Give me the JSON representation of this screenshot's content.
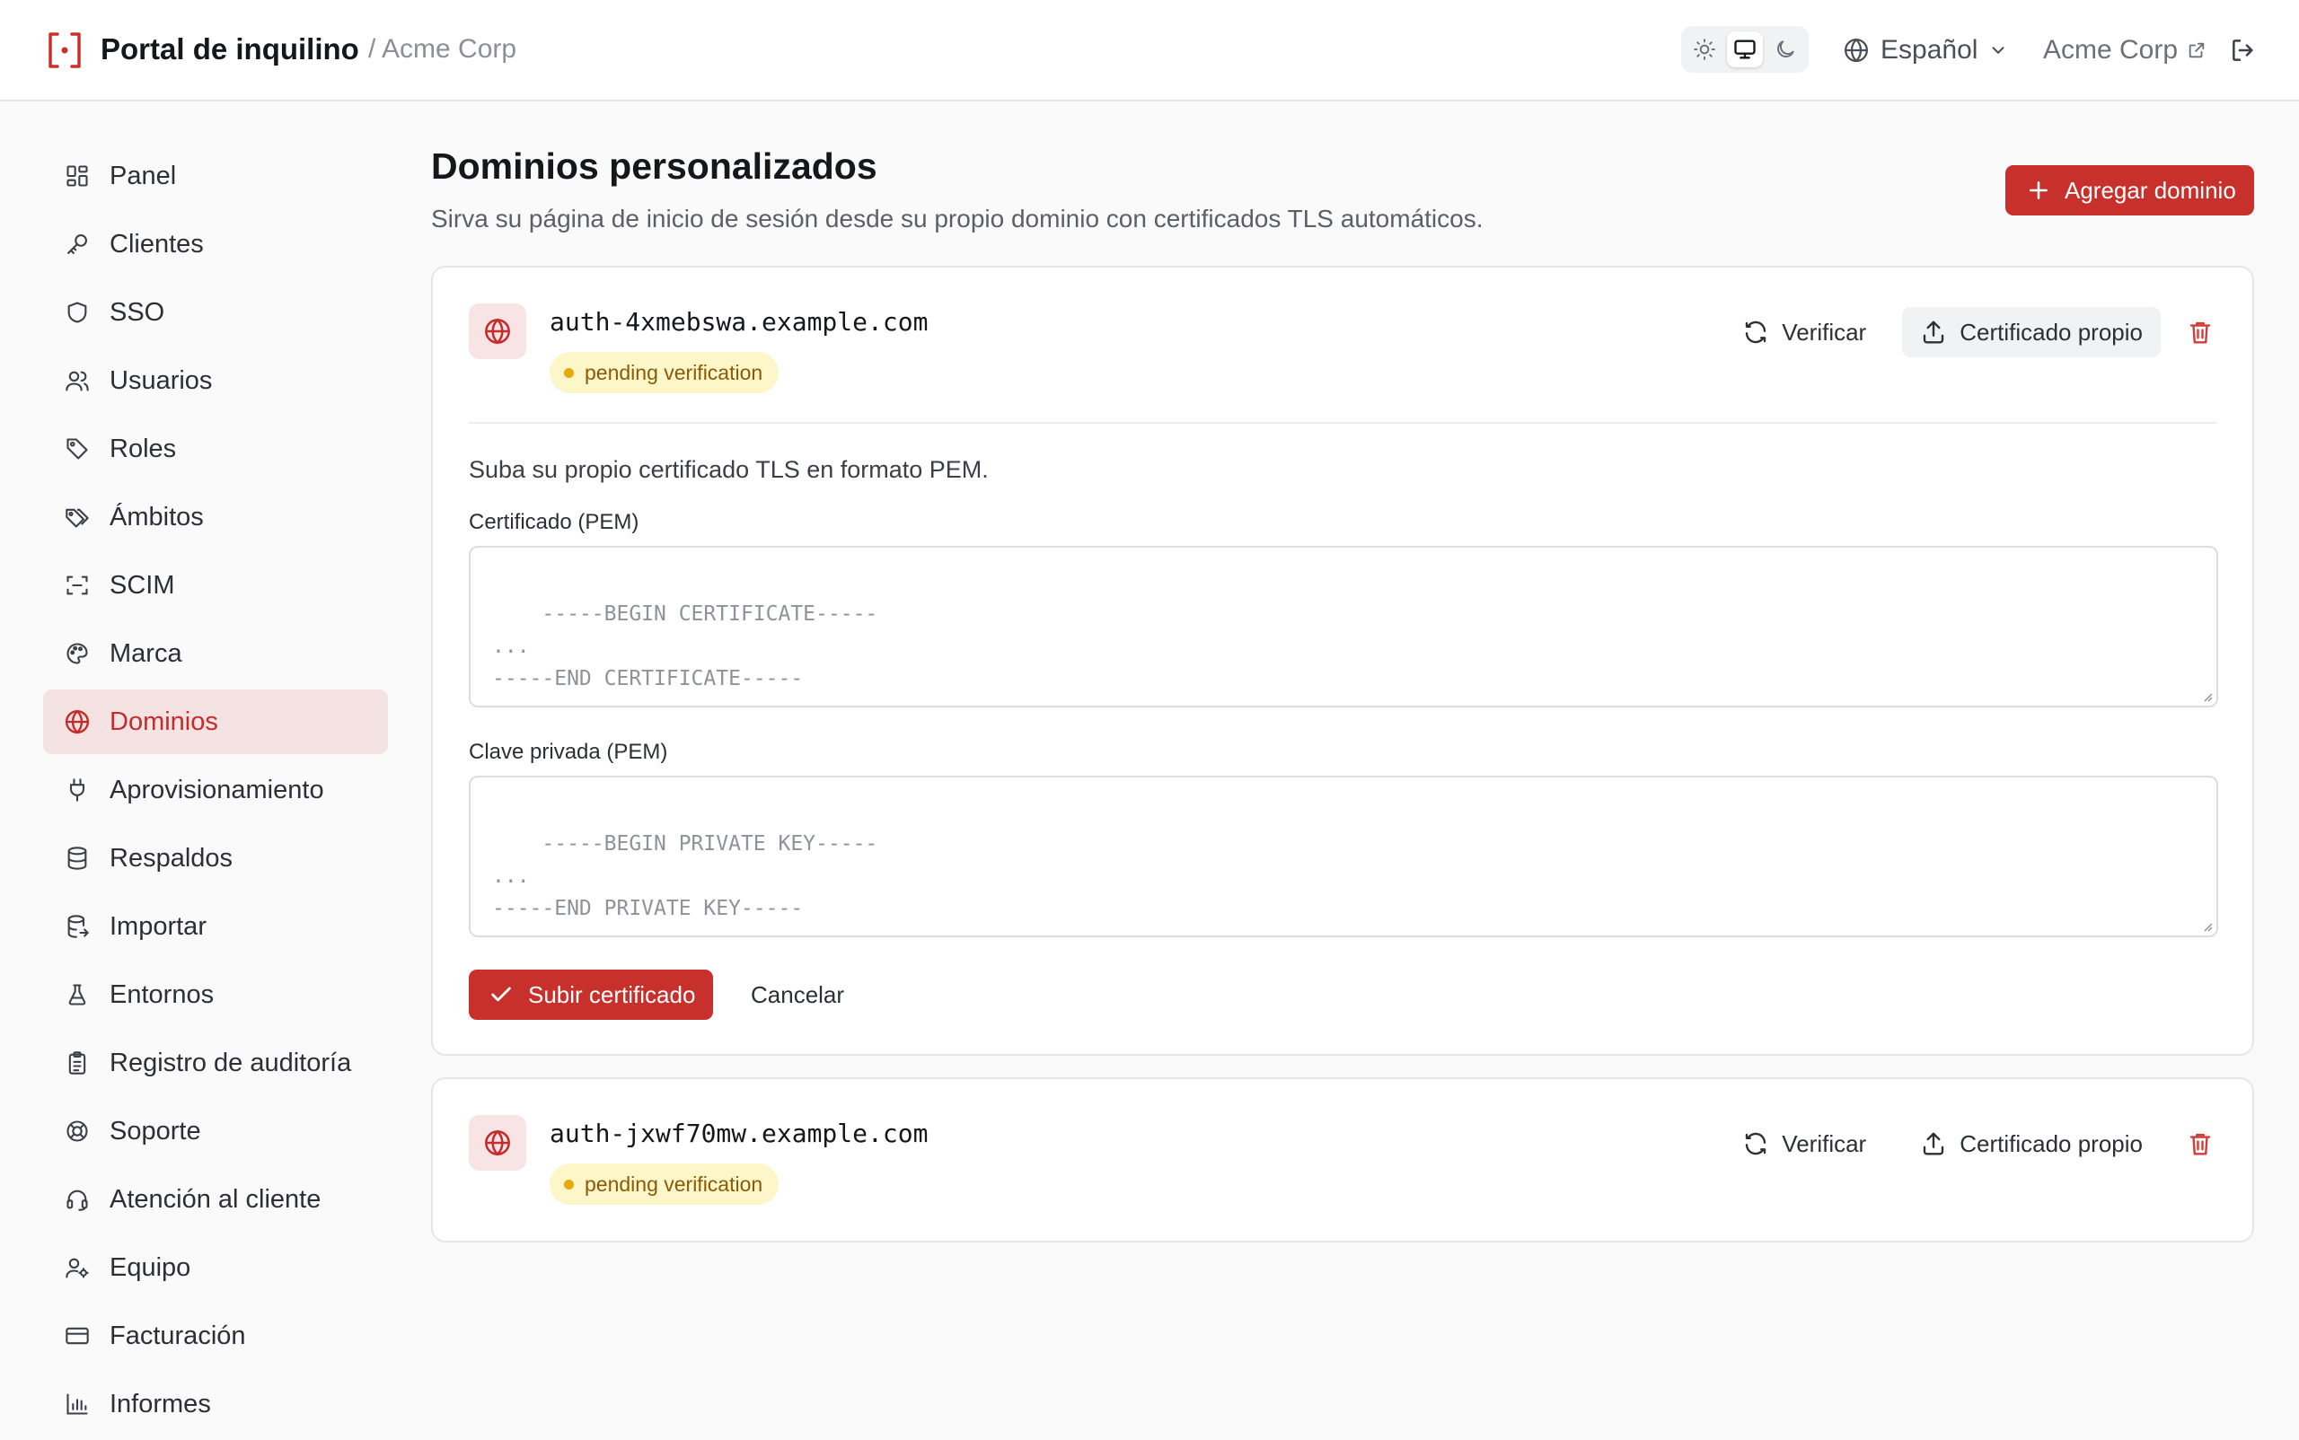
{
  "header": {
    "app_title": "Portal de inquilino",
    "breadcrumb": "/ Acme Corp",
    "theme_options": [
      "light-icon",
      "system-icon",
      "dark-icon"
    ],
    "theme_selected": "system",
    "language": "Español",
    "org_name": "Acme Corp"
  },
  "sidebar": {
    "items": [
      {
        "label": "Panel",
        "icon": "dashboard-icon"
      },
      {
        "label": "Clientes",
        "icon": "key-icon"
      },
      {
        "label": "SSO",
        "icon": "shield-icon"
      },
      {
        "label": "Usuarios",
        "icon": "users-icon"
      },
      {
        "label": "Roles",
        "icon": "tag-icon"
      },
      {
        "label": "Ámbitos",
        "icon": "tags-icon"
      },
      {
        "label": "SCIM",
        "icon": "scan-icon"
      },
      {
        "label": "Marca",
        "icon": "palette-icon"
      },
      {
        "label": "Dominios",
        "icon": "globe-icon",
        "active": true
      },
      {
        "label": "Aprovisionamiento",
        "icon": "plug-icon"
      },
      {
        "label": "Respaldos",
        "icon": "database-icon"
      },
      {
        "label": "Importar",
        "icon": "database-import-icon"
      },
      {
        "label": "Entornos",
        "icon": "flask-icon"
      },
      {
        "label": "Registro de auditoría",
        "icon": "clipboard-icon"
      },
      {
        "label": "Soporte",
        "icon": "lifebuoy-icon"
      },
      {
        "label": "Atención al cliente",
        "icon": "headset-icon"
      },
      {
        "label": "Equipo",
        "icon": "user-cog-icon"
      },
      {
        "label": "Facturación",
        "icon": "credit-card-icon"
      },
      {
        "label": "Informes",
        "icon": "bar-chart-icon"
      }
    ]
  },
  "main": {
    "title": "Dominios personalizados",
    "subtitle": "Sirva su página de inicio de sesión desde su propio dominio con certificados TLS automáticos.",
    "add_domain_label": "Agregar dominio",
    "domains": [
      {
        "name": "auth-4xmebswa.example.com",
        "status": "pending verification",
        "verify_label": "Verificar",
        "own_cert_label": "Certificado propio",
        "upload_form": {
          "hint": "Suba su propio certificado TLS en formato PEM.",
          "cert_label": "Certificado (PEM)",
          "cert_placeholder": "-----BEGIN CERTIFICATE-----\n...\n-----END CERTIFICATE-----",
          "key_label": "Clave privada (PEM)",
          "key_placeholder": "-----BEGIN PRIVATE KEY-----\n...\n-----END PRIVATE KEY-----",
          "submit_label": "Subir certificado",
          "cancel_label": "Cancelar"
        }
      },
      {
        "name": "auth-jxwf70mw.example.com",
        "status": "pending verification",
        "verify_label": "Verificar",
        "own_cert_label": "Certificado propio"
      }
    ]
  },
  "colors": {
    "accent": "#c8302c",
    "active_nav_bg": "#f5e3e3",
    "badge_bg": "#fdf6c8",
    "badge_dot": "#e6a90a"
  }
}
